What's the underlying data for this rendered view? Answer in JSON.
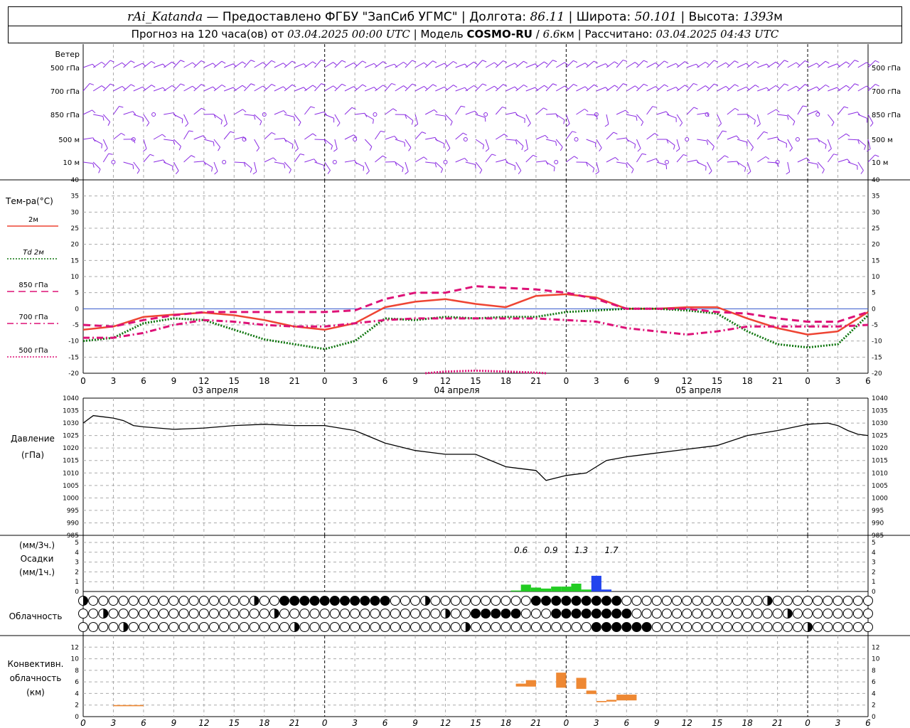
{
  "header": {
    "station": "rAi_Katanda",
    "dash": "—",
    "provider": "Предоставлено ФГБУ \"ЗапСиб УГМС\"",
    "lon_label": "Долгота:",
    "lon": "86.11",
    "lat_label": "Широта:",
    "lat": "50.101",
    "alt_label": "Высота:",
    "alt": "1393",
    "alt_unit": "м",
    "forecast_label": "Прогноз на 120 часа(ов) от",
    "forecast_start": "03.04.2025 00:00 UTC",
    "model_label": "Модель",
    "model": "COSMO-RU",
    "model_res": "6.6",
    "model_res_unit": "км",
    "computed_label": "Рассчитано:",
    "computed": "03.04.2025 04:43 UTC",
    "sep": "|",
    "slash": "/"
  },
  "colors": {
    "wind": "#8a2be2",
    "t2m": "#ee4433",
    "td2m": "#117711",
    "t850": "#dd1177",
    "t700": "#dd1177",
    "t500": "#dd1177",
    "pressure": "#000000",
    "precip_light": "#22cc22",
    "precip_heavy": "#2244ee",
    "convective": "#ee8833",
    "grid": "#aaaaaa",
    "zero_line": "#3355cc"
  },
  "chart_data": [
    {
      "id": "wind",
      "type": "wind-barbs",
      "title": "Ветер",
      "levels": [
        "500 гПа",
        "700 гПа",
        "850 гПа",
        "500 м",
        "10 м"
      ]
    },
    {
      "id": "temperature",
      "type": "line",
      "title": "Тем-ра(°C)",
      "ylim": [
        -20,
        40
      ],
      "yticks": [
        -20,
        -15,
        -10,
        -5,
        0,
        5,
        10,
        15,
        20,
        25,
        30,
        35,
        40
      ],
      "xticks": [
        "0",
        "3",
        "6",
        "9",
        "12",
        "15",
        "18",
        "21",
        "0",
        "3",
        "6",
        "9",
        "12",
        "15",
        "18",
        "21",
        "0",
        "3",
        "6",
        "9",
        "12",
        "15",
        "18",
        "21",
        "0",
        "3",
        "6"
      ],
      "day_labels": [
        "03 апреля",
        "04 апреля",
        "05 апреля"
      ],
      "series": [
        {
          "name": "2м",
          "style": "solid",
          "x": [
            0,
            3,
            6,
            9,
            12,
            15,
            18,
            21,
            24,
            27,
            30,
            33,
            36,
            39,
            42,
            45,
            48,
            51,
            54,
            57,
            60,
            63,
            66,
            69,
            72,
            75,
            78
          ],
          "values": [
            -6.5,
            -5.5,
            -2.5,
            -1.8,
            -1.2,
            -2.0,
            -3.5,
            -5.5,
            -6.5,
            -4.5,
            0.5,
            2.2,
            3.0,
            1.5,
            0.5,
            4.0,
            4.5,
            3.5,
            0.0,
            0.0,
            0.5,
            0.5,
            -3.0,
            -6.0,
            -8.0,
            -7.0,
            -1.0
          ]
        },
        {
          "name": "Td 2м",
          "style": "dotted",
          "x": [
            0,
            3,
            6,
            9,
            12,
            15,
            18,
            21,
            24,
            27,
            30,
            33,
            36,
            39,
            42,
            45,
            48,
            51,
            54,
            57,
            60,
            63,
            66,
            69,
            72,
            75,
            78
          ],
          "values": [
            -10,
            -9,
            -4.5,
            -3,
            -3.5,
            -6.5,
            -9.5,
            -11,
            -12.5,
            -10,
            -3,
            -3.5,
            -2.5,
            -3,
            -2.5,
            -2.5,
            -1,
            -0.5,
            0,
            0,
            -0.5,
            -1.5,
            -7,
            -11,
            -12,
            -11,
            -2
          ]
        },
        {
          "name": "850 гПа",
          "style": "dashed",
          "x": [
            0,
            3,
            6,
            9,
            12,
            15,
            18,
            21,
            24,
            27,
            30,
            33,
            36,
            39,
            42,
            45,
            48,
            51,
            54,
            57,
            60,
            63,
            66,
            69,
            72,
            75,
            78
          ],
          "values": [
            -5,
            -5.5,
            -3.5,
            -2,
            -1,
            -1,
            -1,
            -1,
            -1,
            -0.5,
            3,
            5,
            5,
            7,
            6.5,
            6,
            5,
            3,
            0,
            0,
            0,
            -1,
            -1.5,
            -3,
            -4,
            -4,
            -1
          ]
        },
        {
          "name": "700 гПа",
          "style": "dashdot",
          "x": [
            0,
            3,
            6,
            9,
            12,
            15,
            18,
            21,
            24,
            27,
            30,
            33,
            36,
            39,
            42,
            45,
            48,
            51,
            54,
            57,
            60,
            63,
            66,
            69,
            72,
            75,
            78
          ],
          "values": [
            -9,
            -9,
            -7.5,
            -5,
            -3.5,
            -4,
            -5,
            -5.5,
            -5.5,
            -4.5,
            -3.5,
            -3,
            -3,
            -3,
            -3,
            -3,
            -3.5,
            -4,
            -6,
            -7,
            -8,
            -7,
            -5.5,
            -5.5,
            -5.5,
            -5.5,
            -5
          ]
        },
        {
          "name": "500 гПа",
          "style": "dotted",
          "x": [
            34,
            36,
            39,
            42,
            45,
            46
          ],
          "values": [
            -20,
            -19.5,
            -19.2,
            -19.5,
            -19.8,
            -20
          ]
        }
      ]
    },
    {
      "id": "pressure",
      "type": "line",
      "title": "Давление",
      "ylabel": "(гПа)",
      "ylim": [
        985,
        1040
      ],
      "yticks": [
        985,
        990,
        995,
        1000,
        1005,
        1010,
        1015,
        1020,
        1025,
        1030,
        1035,
        1040
      ],
      "series": [
        {
          "name": "Давление",
          "x": [
            0,
            1,
            2,
            3,
            4,
            5,
            6,
            9,
            12,
            15,
            18,
            21,
            24,
            27,
            30,
            33,
            36,
            39,
            42,
            43,
            45,
            46,
            48,
            50,
            51,
            52,
            54,
            57,
            60,
            63,
            66,
            69,
            72,
            74,
            75,
            76,
            77,
            78
          ],
          "values": [
            1030,
            1033,
            1032.5,
            1032,
            1031,
            1029,
            1028.5,
            1027.5,
            1028,
            1029,
            1029.5,
            1029,
            1029,
            1027,
            1022,
            1019,
            1017.5,
            1017.5,
            1012.5,
            1012,
            1011,
            1007,
            1009,
            1010,
            1012.5,
            1015,
            1016.5,
            1018,
            1019.5,
            1021,
            1025,
            1027,
            1029.5,
            1030,
            1029,
            1027,
            1025.5,
            1025
          ]
        }
      ]
    },
    {
      "id": "precipitation",
      "type": "bar",
      "title": "Осадки",
      "ylabel_3h": "(мм/3ч.)",
      "ylabel_1h": "(мм/1ч.)",
      "ylim": [
        0,
        5
      ],
      "yticks": [
        0,
        1,
        2,
        3,
        4,
        5
      ],
      "totals": [
        {
          "x": 43.5,
          "label": "0.6"
        },
        {
          "x": 46.5,
          "label": "0.9"
        },
        {
          "x": 49.5,
          "label": "1.3"
        },
        {
          "x": 52.5,
          "label": "1.7"
        }
      ],
      "bars": [
        {
          "x": 43,
          "value": 0.1,
          "kind": "light"
        },
        {
          "x": 44,
          "value": 0.7,
          "kind": "light"
        },
        {
          "x": 45,
          "value": 0.4,
          "kind": "light"
        },
        {
          "x": 46,
          "value": 0.3,
          "kind": "light"
        },
        {
          "x": 47,
          "value": 0.5,
          "kind": "light"
        },
        {
          "x": 48,
          "value": 0.5,
          "kind": "light"
        },
        {
          "x": 49,
          "value": 0.8,
          "kind": "light"
        },
        {
          "x": 50,
          "value": 0.2,
          "kind": "light"
        },
        {
          "x": 51,
          "value": 1.6,
          "kind": "heavy"
        },
        {
          "x": 52,
          "value": 0.2,
          "kind": "heavy"
        }
      ]
    },
    {
      "id": "cloudiness",
      "type": "symbols",
      "title": "Облачность",
      "rows": [
        {
          "name": "upper",
          "full_from": 20,
          "full_to": 30,
          "full2_from": 45,
          "full2_to": 53
        },
        {
          "name": "middle",
          "full_from": 39,
          "full_to": 43,
          "full2_from": 47,
          "full2_to": 54
        },
        {
          "name": "lower",
          "full_from": 51,
          "full_to": 56,
          "full2_from": -1,
          "full2_to": -1
        }
      ]
    },
    {
      "id": "convective",
      "type": "bar",
      "title": "Конвективн. облачность",
      "ylabel": "(км)",
      "ylim": [
        0,
        14
      ],
      "yticks": [
        0,
        2,
        4,
        6,
        8,
        10,
        12
      ],
      "segments": [
        {
          "x0": 3,
          "x1": 6,
          "bottom": 1.8,
          "top": 2.0
        },
        {
          "x0": 43,
          "x1": 45,
          "bottom": 5.2,
          "top": 5.7
        },
        {
          "x0": 44,
          "x1": 45,
          "bottom": 5.2,
          "top": 6.3
        },
        {
          "x0": 47,
          "x1": 48,
          "bottom": 5.0,
          "top": 7.6
        },
        {
          "x0": 49,
          "x1": 50,
          "bottom": 4.8,
          "top": 6.7
        },
        {
          "x0": 50,
          "x1": 51,
          "bottom": 3.9,
          "top": 4.5
        },
        {
          "x0": 51,
          "x1": 52,
          "bottom": 2.5,
          "top": 2.7
        },
        {
          "x0": 52,
          "x1": 53,
          "bottom": 2.6,
          "top": 2.9
        },
        {
          "x0": 53,
          "x1": 55,
          "bottom": 2.8,
          "top": 3.8
        }
      ]
    }
  ]
}
